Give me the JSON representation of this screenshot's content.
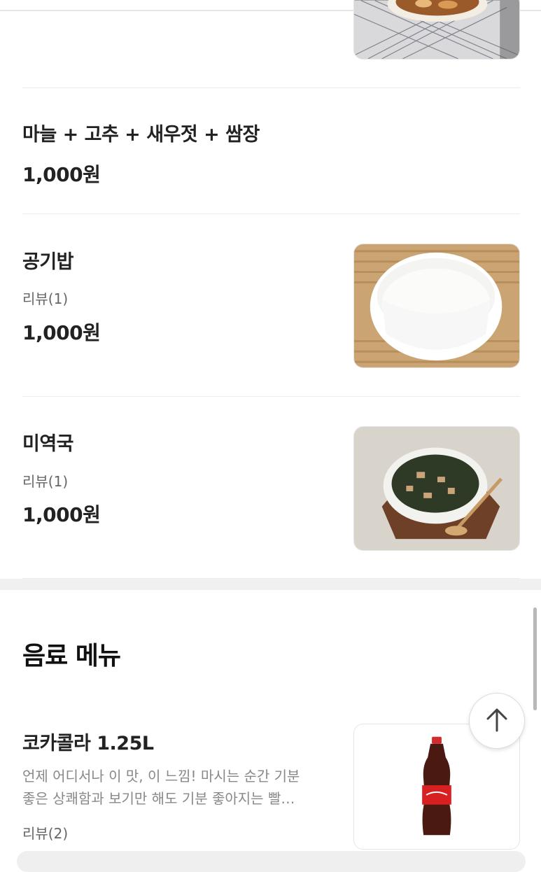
{
  "menu_items": [
    {
      "name": "마늘 + 고추 + 새우젓 + 쌈장",
      "price": "1,000원"
    },
    {
      "name": "공기밥",
      "review": "리뷰(1)",
      "price": "1,000원"
    },
    {
      "name": "미역국",
      "review": "리뷰(1)",
      "price": "1,000원"
    }
  ],
  "beverage_section": {
    "title": "음료 메뉴",
    "item": {
      "name": "코카콜라 1.25L",
      "desc_line1": "언제 어디서나 이 맛, 이 느낌! 마시는 순간 기분",
      "desc_line2": "좋은 상쾌함과 보기만 해도 기분 좋아지는 빨…",
      "review": "리뷰(2)"
    }
  },
  "icons": {
    "scroll_top": "arrow-up-icon"
  }
}
